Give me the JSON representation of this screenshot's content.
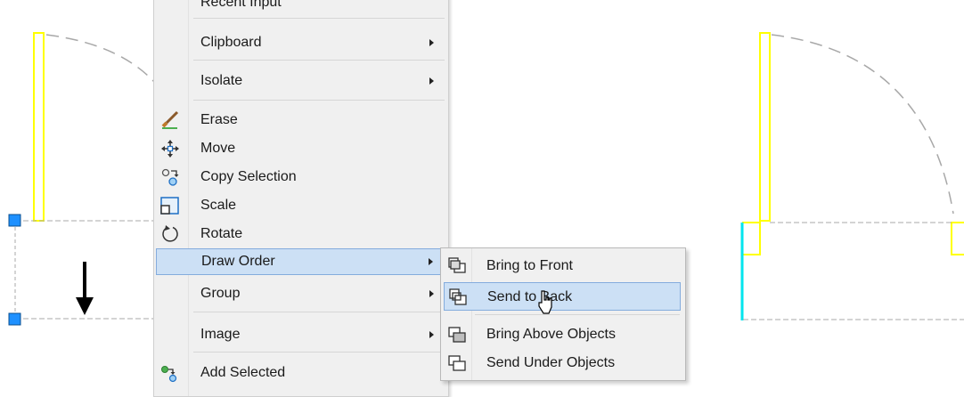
{
  "context_menu": {
    "items": [
      {
        "label": "Recent Input",
        "icon": "none",
        "submenu": true
      },
      {
        "label": "Clipboard",
        "icon": "none",
        "submenu": true
      },
      {
        "label": "Isolate",
        "icon": "none",
        "submenu": true
      },
      {
        "label": "Erase",
        "icon": "erase-icon",
        "submenu": false
      },
      {
        "label": "Move",
        "icon": "move-icon",
        "submenu": false
      },
      {
        "label": "Copy Selection",
        "icon": "copy-selection-icon",
        "submenu": false
      },
      {
        "label": "Scale",
        "icon": "scale-icon",
        "submenu": false
      },
      {
        "label": "Rotate",
        "icon": "rotate-icon",
        "submenu": false
      },
      {
        "label": "Draw Order",
        "icon": "none",
        "submenu": true,
        "highlighted": true
      },
      {
        "label": "Group",
        "icon": "none",
        "submenu": true
      },
      {
        "label": "Image",
        "icon": "none",
        "submenu": true
      },
      {
        "label": "Add Selected",
        "icon": "add-selected-icon",
        "submenu": false
      }
    ]
  },
  "draw_order_submenu": {
    "items": [
      {
        "label": "Bring to Front",
        "icon": "bring-to-front-icon"
      },
      {
        "label": "Send to Back",
        "icon": "send-to-back-icon",
        "highlighted": true
      },
      {
        "label": "Bring Above Objects",
        "icon": "bring-above-objects-icon"
      },
      {
        "label": "Send Under Objects",
        "icon": "send-under-objects-icon"
      }
    ]
  },
  "colors": {
    "menu_bg": "#f0f0f0",
    "highlight_bg": "#cce0f5",
    "highlight_border": "#84acdd",
    "drawing_yellow": "#ffff00",
    "drawing_cyan": "#00e5ee",
    "grip_blue": "#1e90ff",
    "dashed_gray": "#a0a0a0"
  }
}
